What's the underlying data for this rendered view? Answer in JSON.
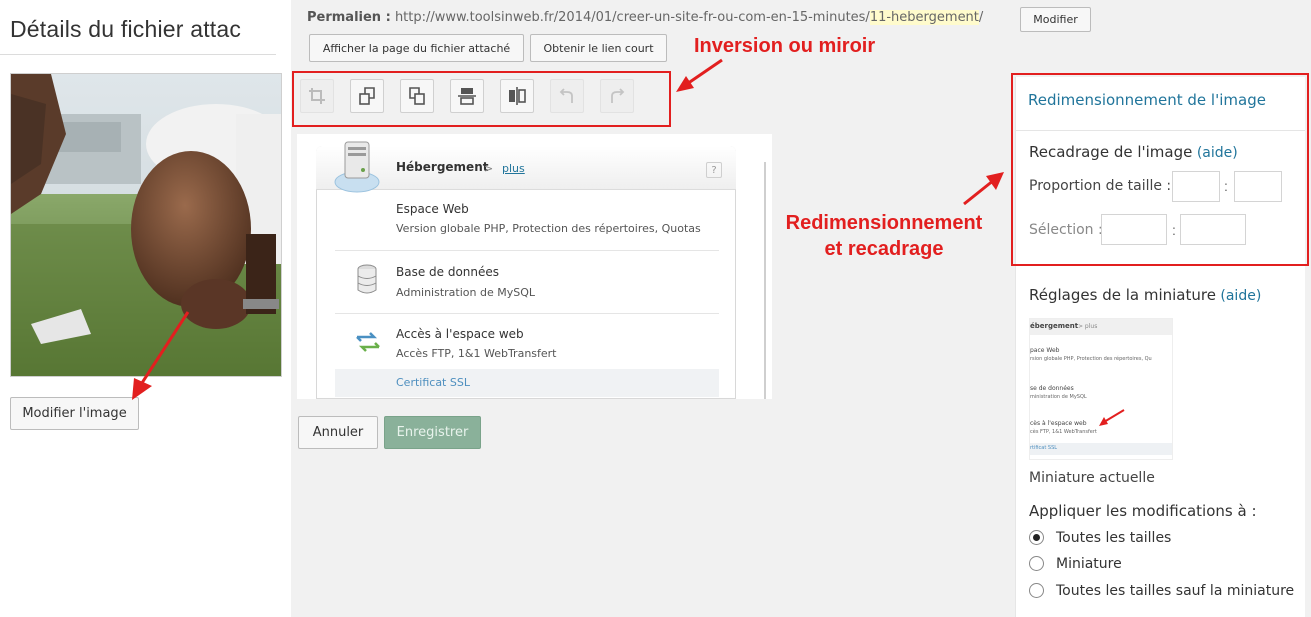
{
  "left": {
    "title": "Détails du fichier attac",
    "edit_image_button": "Modifier l'image"
  },
  "header": {
    "permalink_label": "Permalien :",
    "permalink_base": "http://www.toolsinweb.fr/2014/01/creer-un-site-fr-ou-com-en-15-minutes/",
    "permalink_slug": "11-hebergement",
    "permalink_trailing": "/",
    "modify_button": "Modifier",
    "view_attachment_button": "Afficher la page du fichier attaché",
    "short_link_button": "Obtenir le lien court"
  },
  "annotations": {
    "flip": "Inversion ou miroir",
    "resize_line1": "Redimensionnement",
    "resize_line2": "et recadrage"
  },
  "toolbar": {
    "tools": [
      {
        "icon": "crop-icon",
        "enabled": false
      },
      {
        "icon": "rotate-left-icon",
        "enabled": true
      },
      {
        "icon": "rotate-right-icon",
        "enabled": true
      },
      {
        "icon": "flip-vertical-icon",
        "enabled": true
      },
      {
        "icon": "flip-horizontal-icon",
        "enabled": true
      },
      {
        "icon": "undo-icon",
        "enabled": false
      },
      {
        "icon": "redo-icon",
        "enabled": false
      }
    ]
  },
  "preview": {
    "title": "Hébergement",
    "more_prefix": "> ",
    "more_link": "plus",
    "help": "?",
    "rows": [
      {
        "title": "Espace Web",
        "subtitle": "Version globale PHP, Protection des répertoires, Quotas"
      },
      {
        "title": "Base de données",
        "subtitle": "Administration de MySQL"
      },
      {
        "title": "Accès à l'espace web",
        "subtitle": "Accès FTP, 1&1 WebTransfert"
      }
    ],
    "ssl": "Certificat SSL"
  },
  "actions": {
    "cancel": "Annuler",
    "save": "Enregistrer"
  },
  "sidebar": {
    "resize_header": "Redimensionnement de l'image",
    "crop_title": "Recadrage de l'image",
    "help": "(aide)",
    "ratio_label": "Proportion de taille :",
    "selection_label": "Sélection :",
    "colon": ":",
    "thumb_title": "Réglages de la miniature",
    "thumb_lines": {
      "title": "ébergement",
      "more": "> plus",
      "row1_title": "pace Web",
      "row1_sub": "rsion globale PHP, Protection des répertoires, Qu",
      "row2_title": "se de données",
      "row2_sub": "ministration de MySQL",
      "row3_title": "cès à l'espace web",
      "row3_sub": "cès FTP, 1&1 WebTransfert",
      "ssl": "rtificat SSL"
    },
    "current_thumb": "Miniature actuelle",
    "apply_title": "Appliquer les modifications à :",
    "apply_options": [
      {
        "label": "Toutes les tailles",
        "checked": true
      },
      {
        "label": "Miniature",
        "checked": false
      },
      {
        "label": "Toutes les tailles sauf la miniature",
        "checked": false
      }
    ]
  },
  "colors": {
    "annotation_red": "#e21f1f",
    "link_blue": "#21759b",
    "save_green": "#8ab19a"
  }
}
